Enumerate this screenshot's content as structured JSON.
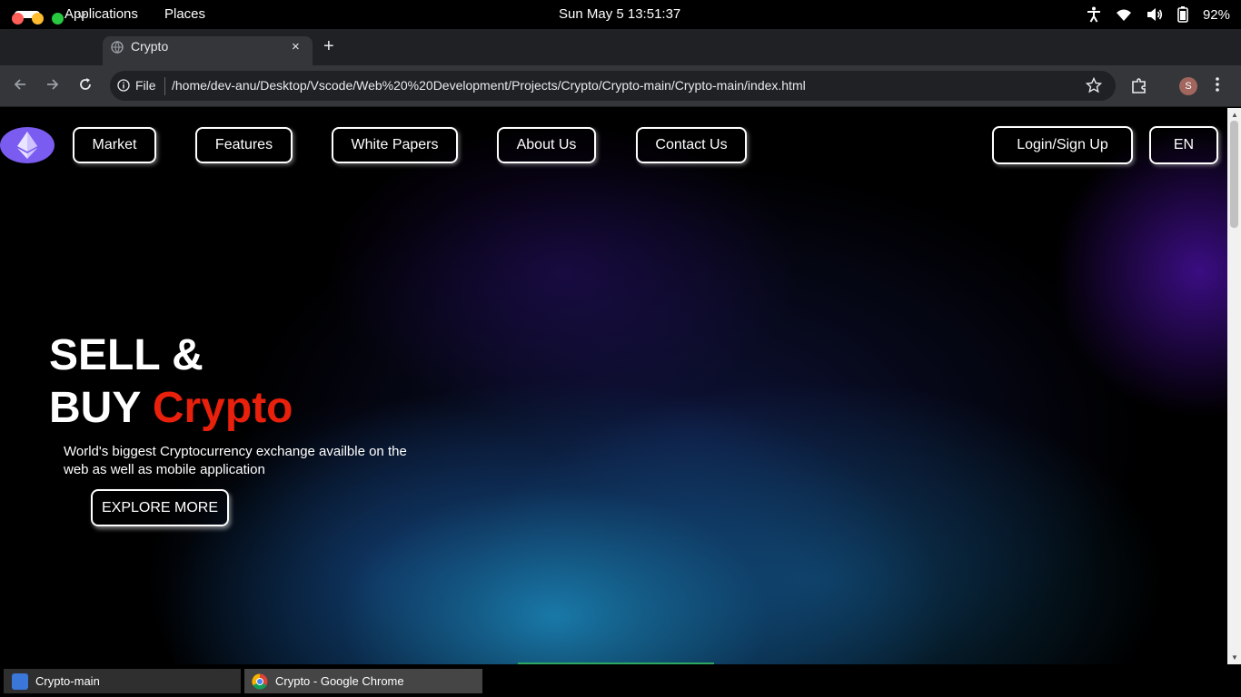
{
  "system_bar": {
    "applications": "Applications",
    "places": "Places",
    "clock": "Sun May 5  13:51:37",
    "battery": "92%"
  },
  "browser": {
    "tab_title": "Crypto",
    "new_tab": "+",
    "close": "×",
    "omnibox_scheme": "File",
    "url": "/home/dev-anu/Desktop/Vscode/Web%20%20Development/Projects/Crypto/Crypto-main/Crypto-main/index.html",
    "profile_initial": "S"
  },
  "page": {
    "nav": {
      "items": [
        "Market",
        "Features",
        "White Papers",
        "About Us",
        "Contact Us"
      ],
      "login": "Login/Sign Up",
      "language": "EN"
    },
    "hero": {
      "line1": "SELL &",
      "line2_plain": "BUY",
      "line2_accent": "Crypto",
      "subtitle": "World's biggest Cryptocurrency exchange availble on the web as well as mobile application",
      "cta": "EXPLORE MORE"
    },
    "colors": {
      "accent": "#e8200c",
      "logo": "#7b5cf0"
    }
  },
  "taskbar": {
    "items": [
      "Crypto-main",
      "Crypto - Google Chrome"
    ]
  }
}
